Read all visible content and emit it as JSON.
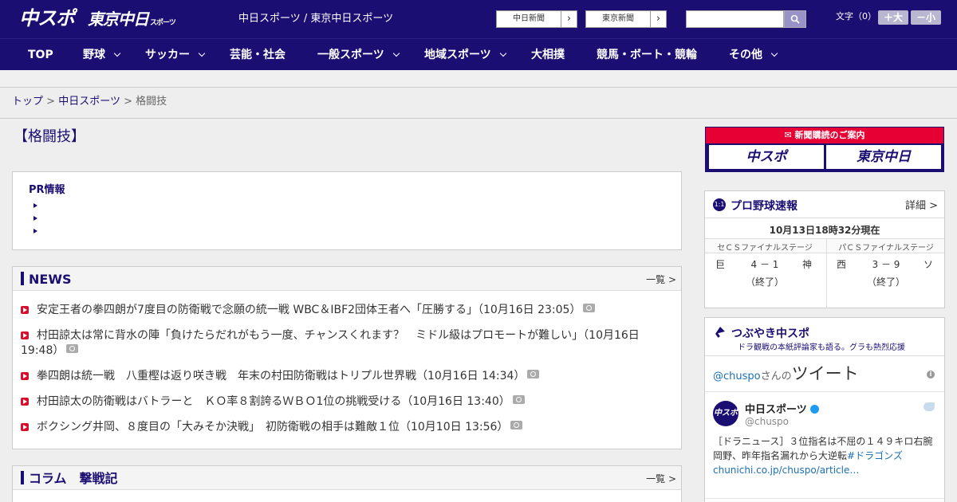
{
  "header": {
    "logo_chuspo": "中スポ",
    "logo_tokyo": "東京中日",
    "logo_tokyo_sub": "スポーツ",
    "site_title": "中日スポーツ / 東京中日スポーツ",
    "chunichi_label": "中日新聞",
    "tokyo_label": "東京新聞",
    "search_placeholder": "",
    "font_label": "文字（0）",
    "font_large": "＋大",
    "font_small": "－小"
  },
  "nav": {
    "items": [
      {
        "label": "TOP"
      },
      {
        "label": "野球"
      },
      {
        "label": "サッカー"
      },
      {
        "label": "芸能・社会"
      },
      {
        "label": "一般スポーツ"
      },
      {
        "label": "地域スポーツ"
      },
      {
        "label": "大相撲"
      },
      {
        "label": "競馬・ボート・競輪"
      },
      {
        "label": "その他"
      }
    ]
  },
  "breadcrumb": {
    "items": [
      "トップ",
      "中日スポーツ"
    ],
    "sep": ">",
    "current": "格闘技"
  },
  "main": {
    "page_title": "【格闘技】",
    "pr": {
      "title": "PR情報"
    },
    "news": {
      "title": "NEWS",
      "more": "一覧 >",
      "items": [
        {
          "text": "安定王者の拳四朗が7度目の防衛戦で念願の統一戦 WBC＆IBF2団体王者へ「圧勝する」（10月16日 23:05）"
        },
        {
          "text": "村田諒太は常に背水の陣「負けたらだれがもう一度、チャンスくれます？　ミドル級はプロモートが難しい」（10月16日 19:48）"
        },
        {
          "text": "拳四朗は統一戦　八重樫は返り咲き戦　年末の村田防衛戦はトリプル世界戦（10月16日 14:34）"
        },
        {
          "text": "村田諒太の防衛戦はバトラーと　ＫＯ率８割誇るＷＢＯ1位の挑戦受ける（10月16日 13:40）"
        },
        {
          "text": "ボクシング井岡、８度目の「大みそか決戦」　初防衛戦の相手は難敵１位（10月10日 13:56）"
        }
      ]
    },
    "column": {
      "title": "コラム　撃戦記",
      "more": "一覧 >"
    }
  },
  "sidebar": {
    "subscribe": {
      "title": "新聞購読のご案内",
      "left": "中スポ",
      "right": "東京中日"
    },
    "baseball": {
      "icon": "1:1",
      "title": "プロ野球速報",
      "detail": "詳細 >",
      "time": "10月13日18時32分現在",
      "games": [
        {
          "stage": "セＣＳファイナルステージ",
          "home": "巨",
          "score": "4 － 1",
          "away": "神",
          "status": "（終了）"
        },
        {
          "stage": "パＣＳファイナルステージ",
          "home": "西",
          "score": "3 － 9",
          "away": "ソ",
          "status": "（終了）"
        }
      ]
    },
    "twitter": {
      "title": "つぶやき中スポ",
      "subtitle": "ドラ観戦の本紙評論家も語る。グラも熱烈応援",
      "handle_link": "@chuspo",
      "by_suffix": "さんの",
      "tweets_label": "ツイート",
      "avatar_text": "中スポ",
      "name": "中日スポーツ",
      "handle": "@chuspo",
      "tweet_text": "［ドラニュース］３位指名は不屈の１４９キロ右腕　岡野、昨年指名漏れから大逆転",
      "tweet_link": "#ドラゴンズchunichi.co.jp/chuspo/article…"
    }
  }
}
